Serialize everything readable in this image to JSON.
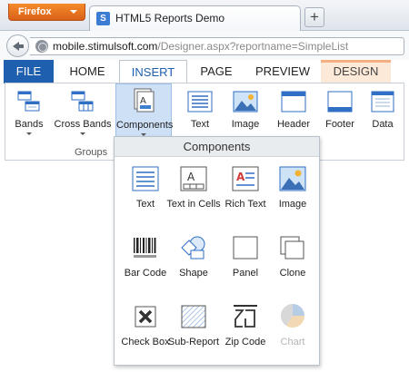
{
  "browser": {
    "menu_button": "Firefox",
    "tab_title": "HTML5 Reports Demo",
    "tab_icon": "stimulsoft-s-icon",
    "tab_icon_glyph": "S",
    "new_tab_glyph": "+",
    "url_domain": "mobile.stimulsoft.com",
    "url_path": "/Designer.aspx?reportname=SimpleList"
  },
  "ribbon": {
    "tabs": [
      {
        "label": "FILE"
      },
      {
        "label": "HOME"
      },
      {
        "label": "INSERT",
        "active": true
      },
      {
        "label": "PAGE"
      },
      {
        "label": "PREVIEW"
      },
      {
        "label": "DESIGN"
      }
    ],
    "buttons": [
      {
        "label": "Bands",
        "icon": "bands-icon"
      },
      {
        "label": "Cross Bands",
        "icon": "cross-bands-icon"
      },
      {
        "label": "Components",
        "icon": "components-icon",
        "selected": true
      },
      {
        "label": "Text",
        "icon": "text-icon"
      },
      {
        "label": "Image",
        "icon": "image-icon"
      },
      {
        "label": "Header",
        "icon": "header-icon"
      },
      {
        "label": "Footer",
        "icon": "footer-icon"
      },
      {
        "label": "Data",
        "icon": "data-icon"
      }
    ],
    "group_label": "Groups"
  },
  "components_menu": {
    "title": "Components",
    "items": [
      {
        "label": "Text",
        "icon": "text-icon"
      },
      {
        "label": "Text in Cells",
        "icon": "text-in-cells-icon"
      },
      {
        "label": "Rich Text",
        "icon": "rich-text-icon"
      },
      {
        "label": "Image",
        "icon": "image-icon"
      },
      {
        "label": "Bar Code",
        "icon": "barcode-icon"
      },
      {
        "label": "Shape",
        "icon": "shape-icon"
      },
      {
        "label": "Panel",
        "icon": "panel-icon"
      },
      {
        "label": "Clone",
        "icon": "clone-icon"
      },
      {
        "label": "Check Box",
        "icon": "checkbox-icon"
      },
      {
        "label": "Sub-Report",
        "icon": "sub-report-icon"
      },
      {
        "label": "Zip Code",
        "icon": "zip-code-icon"
      },
      {
        "label": "Chart",
        "icon": "chart-icon",
        "disabled": true
      }
    ]
  },
  "colors": {
    "file_tab": "#1f5fb0",
    "selected_button": "#cde0f6",
    "design_tab": "#fce9d8",
    "icon_blue": "#2f6fc4"
  }
}
